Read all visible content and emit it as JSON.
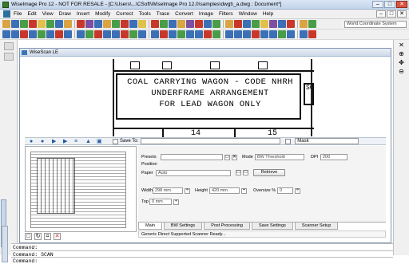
{
  "window": {
    "title": "WiseImage Pro 12 - NOT FOR RESALE - [C:\\Users\\...\\CSoft\\WiseImage Pro 12.0\\samples\\dwgt\\_a.dwg : Document*]",
    "minimize": "–",
    "maximize": "□",
    "close": "✕"
  },
  "menu": {
    "items": [
      "File",
      "Edit",
      "View",
      "Draw",
      "Insert",
      "Modify",
      "Correct",
      "Tools",
      "Trace",
      "Convert",
      "Image",
      "Filters",
      "Window",
      "Help"
    ],
    "mdi_buttons": [
      "–",
      "□",
      "✕"
    ]
  },
  "toolbar": {
    "coordinate_system": "World Coordinate System",
    "row1_colors": [
      "#d9a441",
      "#3b6fb6",
      "#4a9d48",
      "#c7382b",
      "#e1c14b",
      "#4a9d48",
      "#3b6fb6",
      "#d9a441",
      "#c7382b",
      "#7c4fa3",
      "#3b6fb6",
      "#d9a441",
      "#4a9d48",
      "#c7382b",
      "#3b6fb6",
      "#e1c14b",
      "#c7382b",
      "#4a9d48",
      "#3b6fb6",
      "#d9a441",
      "#7c4fa3",
      "#c7382b",
      "#3b6fb6",
      "#4a9d48",
      "#d9a441",
      "#c7382b",
      "#3b6fb6",
      "#4a9d48",
      "#e1c14b",
      "#7c4fa3",
      "#3b6fb6",
      "#c7382b",
      "#d9a441",
      "#4a9d48"
    ],
    "row2_colors": [
      "#3b6fb6",
      "#3b6fb6",
      "#c7382b",
      "#3b6fb6",
      "#4a9d48",
      "#3b6fb6",
      "#c7382b",
      "#3b6fb6",
      "#3b6fb6",
      "#4a9d48",
      "#c7382b",
      "#3b6fb6",
      "#3b6fb6",
      "#c7382b",
      "#4a9d48",
      "#3b6fb6",
      "#3b6fb6",
      "#c7382b",
      "#3b6fb6",
      "#4a9d48",
      "#3b6fb6",
      "#3b6fb6",
      "#c7382b",
      "#4a9d48",
      "#3b6fb6",
      "#3b6fb6",
      "#3b6fb6",
      "#c7382b",
      "#3b6fb6",
      "#3b6fb6",
      "#4a9d48",
      "#3b6fb6",
      "#3b6fb6",
      "#c7382b"
    ]
  },
  "wiscan": {
    "title": "WiseScan LE",
    "drawing": {
      "line1": "COAL CARRYING WAGON - CODE NHRH",
      "line2": "UNDERFRAME ARRANGEMENT",
      "line3": "FOR LEAD WAGON ONLY",
      "side_label": "SC",
      "num_left": "14",
      "num_right": "15"
    },
    "scanbar": {
      "save_to_label": "Save To:",
      "save_to_value": "",
      "mask_label": "Mask",
      "mask_value": ""
    },
    "settings": {
      "presets_label": "Presets",
      "presets_value": "",
      "position_label": "Position",
      "paper_label": "Paper",
      "paper_value": "Auto",
      "mode_label": "Mode",
      "mode_value": "BW Threshold",
      "dpi_label": "DPI",
      "dpi_value": "200",
      "retrieve_label": "Retrieve",
      "width_label": "Width",
      "width_value": "298 mm",
      "height_label": "Height",
      "height_value": "420 mm",
      "oversize_label": "Oversize %",
      "oversize_value": "0",
      "top_label": "Top",
      "top_value": "0 mm"
    },
    "tabs": [
      "Main",
      "BW Settings",
      "Post Processing",
      "Save Settings",
      "Scanner Setup"
    ],
    "status": "Generic Direct Supported Scanner Ready..."
  },
  "command": {
    "line1": "Command:",
    "line2": "Command: SCAN",
    "line3": "Command:"
  }
}
